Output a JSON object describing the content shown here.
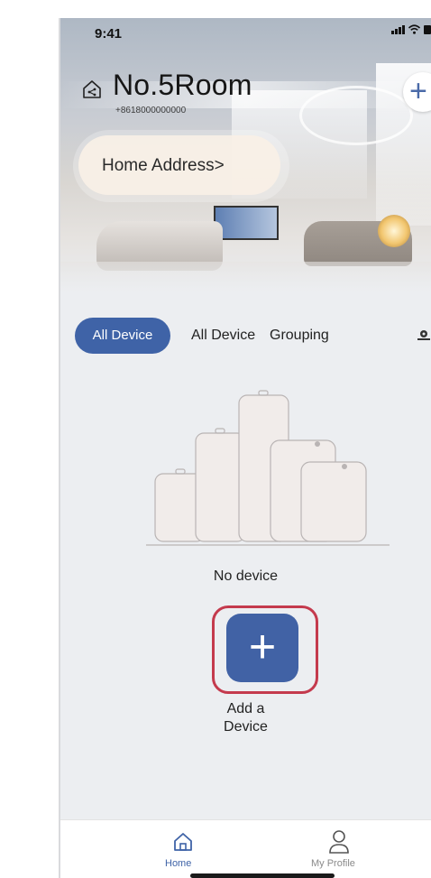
{
  "status_bar": {
    "time": "9:41"
  },
  "header": {
    "room_name": "No.5Room",
    "phone": "+8618000000000",
    "address_button": "Home Address>"
  },
  "filter_tabs": [
    {
      "label": "All Device",
      "active": true
    },
    {
      "label": "All Device",
      "active": false
    },
    {
      "label": "Grouping",
      "active": false
    }
  ],
  "empty_state": {
    "message": "No device",
    "add_label_line1": "Add a",
    "add_label_line2": "Device"
  },
  "bottom_nav": [
    {
      "label": "Home",
      "icon": "home-icon",
      "active": true
    },
    {
      "label": "My Profile",
      "icon": "person-icon",
      "active": false
    }
  ],
  "colors": {
    "accent": "#3f63a7",
    "highlight_frame": "#c43a4d",
    "background": "#eceef1"
  }
}
